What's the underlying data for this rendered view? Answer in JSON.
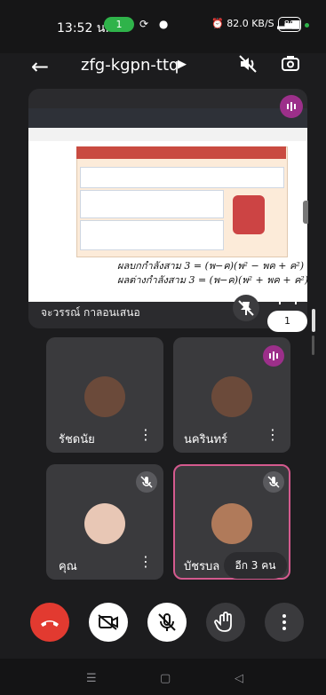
{
  "status_bar": {
    "time": "13:52 น.",
    "call_count": "1",
    "speed": "82.0 KB/S",
    "battery": "89"
  },
  "top_bar": {
    "meeting_code": "zfg-kgpn-ttq"
  },
  "presentation": {
    "presenter_label": "จะวรรณ์ กาลอนเสนอ",
    "page_indicator": "1",
    "handwriting_line1": "ผลบกกำลังสาม 3 = (พ−ค)(พ² − พค + ค²)",
    "handwriting_line2": "ผลต่างกำลังสาม 3 = (พ−ค)(พ² + พค + ค²)"
  },
  "participants": [
    {
      "name": "รัชดนัย",
      "muted": false,
      "speaking": false
    },
    {
      "name": "นครินทร์",
      "muted": false,
      "speaking": true
    },
    {
      "name": "คุณ",
      "muted": true,
      "speaking": false
    },
    {
      "name": "บัชรบล",
      "muted": true,
      "speaking": false
    }
  ],
  "more_participants": "อีก 3 คน",
  "colors": {
    "end_call": "#e23a30",
    "speaking": "#9c2f8a",
    "active_border": "#d45a8e"
  }
}
